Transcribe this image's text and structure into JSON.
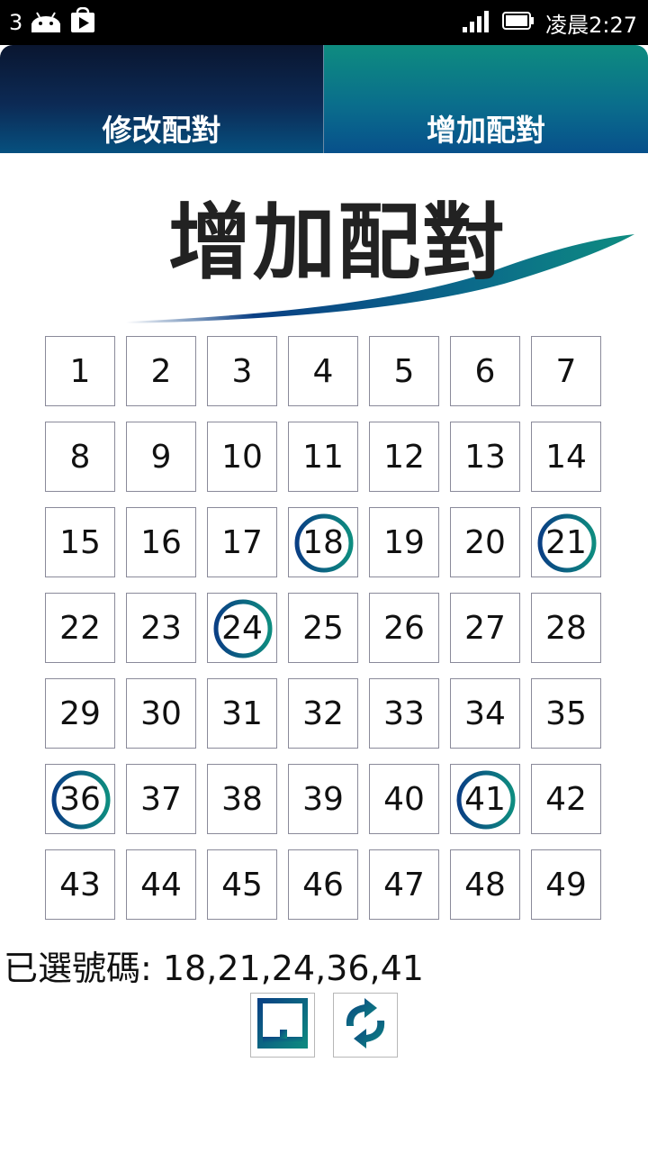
{
  "status_bar": {
    "notification_count": "3",
    "time": "凌晨2:27",
    "icons": [
      "android-icon",
      "play-store-icon",
      "signal-icon",
      "battery-icon"
    ]
  },
  "tabs": [
    {
      "label": "修改配對",
      "active": false
    },
    {
      "label": "增加配對",
      "active": true
    }
  ],
  "page_title": "增加配對",
  "numbers": [
    1,
    2,
    3,
    4,
    5,
    6,
    7,
    8,
    9,
    10,
    11,
    12,
    13,
    14,
    15,
    16,
    17,
    18,
    19,
    20,
    21,
    22,
    23,
    24,
    25,
    26,
    27,
    28,
    29,
    30,
    31,
    32,
    33,
    34,
    35,
    36,
    37,
    38,
    39,
    40,
    41,
    42,
    43,
    44,
    45,
    46,
    47,
    48,
    49
  ],
  "selected_numbers": [
    18,
    21,
    24,
    36,
    41
  ],
  "selected_text": "已選號碼: 18,21,24,36,41",
  "buttons": {
    "save_icon": "save-icon",
    "refresh_icon": "refresh-icon"
  },
  "colors": {
    "accent_teal": "#0e8c80",
    "accent_blue": "#07508b",
    "tab_dark": "#0c2a55"
  }
}
